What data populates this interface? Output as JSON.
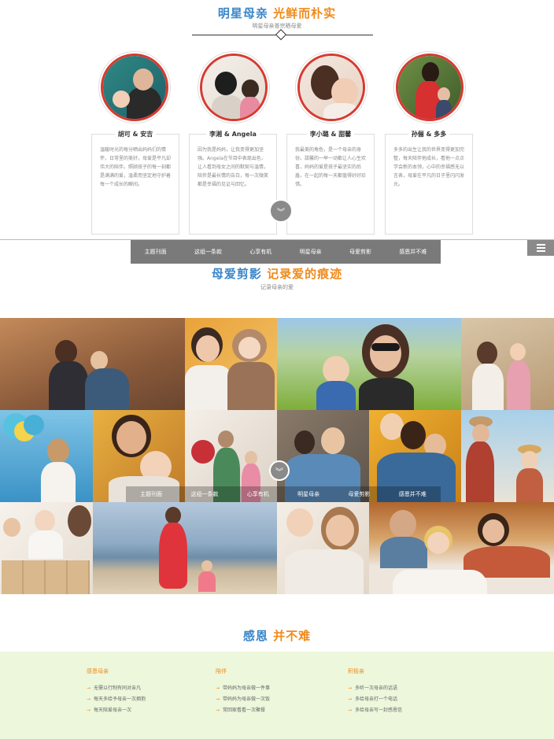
{
  "section1": {
    "title_a": "明星母亲",
    "title_b": "光鲜而朴实",
    "subtitle": "明星母亲普宗晒母爱"
  },
  "cards": [
    {
      "name": "胡可 & 安吉",
      "text": "温暖时光的每分晒出妈妈们的情怀，日常里的美好，母爱是平凡却伟大的陪伴。照顾孩子的每一刻都是满满的爱，温柔而坚定地守护着每一个成长的瞬间。"
    },
    {
      "name": "李湘 & Angela",
      "text": "因为我是妈妈，让我变得更加坚强。Angela在节目中表现出色，让人看到母女之间的默契与温情，陪伴是最长情的告白，每一次微笑都是幸福的见证与回忆。"
    },
    {
      "name": "李小璐 & 甜馨",
      "text": "我最美的角色，是一个母亲的身份。甜馨的一举一动都让人心生欢喜，妈妈的爱是孩子最坚实的后盾，在一起的每一天都值得好好珍惜。"
    },
    {
      "name": "孙俪 & 多多",
      "text": "多多的出生让我的世界变得更加完整，每天陪伴他成长，看他一点点学会新的本领，心中的幸福感无以言表，母爱在平凡的日子里闪闪发光。"
    }
  ],
  "nav": {
    "items": [
      "主题刊面",
      "这组一条款",
      "心享有机",
      "明星母亲",
      "母爱剪影",
      "感恩并不难"
    ]
  },
  "section2": {
    "title_a": "母爱剪影",
    "title_b": "记录爱的痕迹",
    "subtitle": "记录母亲的爱"
  },
  "overlay_nav": {
    "items": [
      "主题刊面",
      "这组一条款",
      "心享有机",
      "明星母亲",
      "母爱剪影",
      "感恩并不难"
    ]
  },
  "section3": {
    "title_a": "感恩",
    "title_b": "并不难"
  },
  "footer": {
    "columns": [
      {
        "heading": "感恩母亲",
        "items": [
          "无需以行制有同对亲凡",
          "每天多给予母亲一次拥抱",
          "每天陪爱母亲一次"
        ]
      },
      {
        "heading": "陪伴",
        "items": [
          "带妈妈为母亲做一件事",
          "带妈妈为母亲做一次饭",
          "常回家看看一次聚餐"
        ]
      },
      {
        "heading": "积极亲",
        "items": [
          "多听一次母亲的话语",
          "多给母亲打一个电话",
          "多给母亲写一封感恩信"
        ]
      }
    ]
  },
  "colors": {
    "blue": "#3a86c8",
    "orange": "#f08a1c",
    "red": "#d83a30",
    "footer_bg": "#edf7dc"
  },
  "icons": {
    "menu": "menu-icon",
    "scroll": "double-chevron-down-icon"
  }
}
